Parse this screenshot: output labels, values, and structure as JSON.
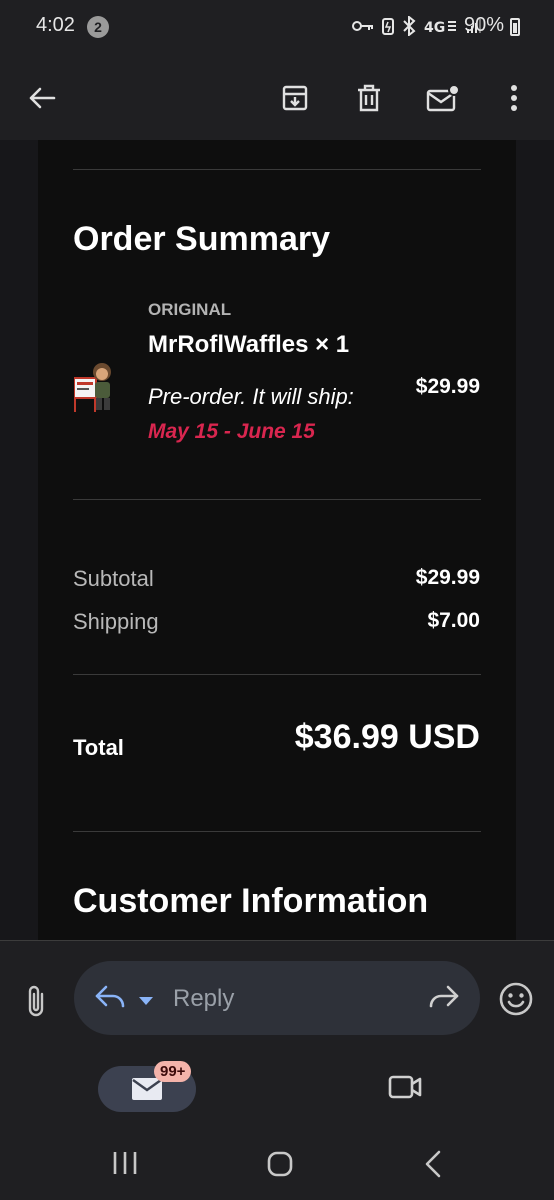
{
  "status_bar": {
    "time": "4:02",
    "notification_count": "2",
    "battery": "90%"
  },
  "order_summary": {
    "heading": "Order Summary",
    "item": {
      "label": "ORIGINAL",
      "name": "MrRoflWaffles × 1",
      "preorder_note": "Pre-order. It will ship:",
      "ship_dates": "May 15 - June 15",
      "price": "$29.99"
    },
    "subtotal_label": "Subtotal",
    "subtotal_value": "$29.99",
    "shipping_label": "Shipping",
    "shipping_value": "$7.00",
    "total_label": "Total",
    "total_value": "$36.99 USD"
  },
  "customer_info": {
    "heading": "Customer Information"
  },
  "reply_bar": {
    "placeholder": "Reply"
  },
  "bottom_nav": {
    "mail_badge": "99+"
  },
  "colors": {
    "accent_dates": "#d9264f",
    "background": "#1f1f22",
    "card": "#0e0e0e"
  },
  "icons": {
    "back": "arrow-left-icon",
    "archive": "archive-icon",
    "delete": "trash-icon",
    "unread": "mark-unread-icon",
    "more": "more-vert-icon",
    "attach": "paperclip-icon",
    "reply": "reply-icon",
    "forward": "forward-icon",
    "emoji": "emoji-icon",
    "mail": "mail-icon",
    "meet": "video-icon"
  }
}
